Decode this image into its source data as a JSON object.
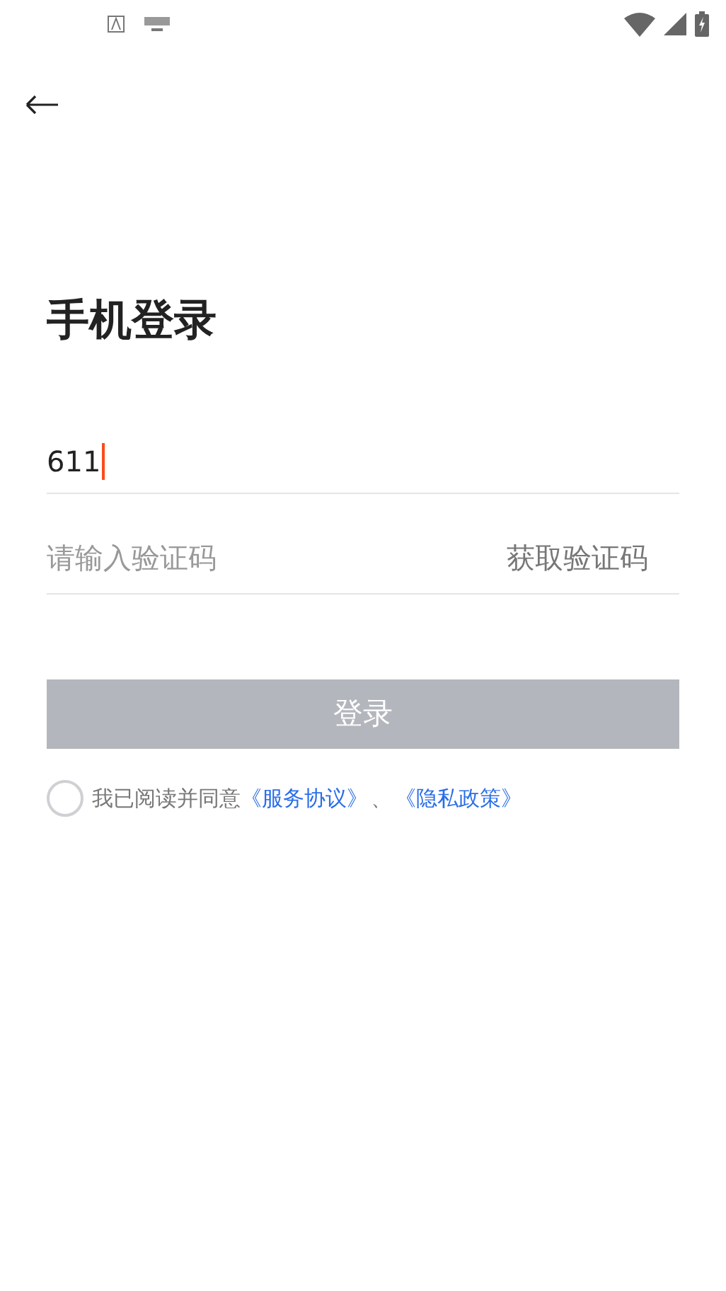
{
  "title": "手机登录",
  "phone_field": {
    "value": "611",
    "focused": true
  },
  "code_field": {
    "placeholder": "请输入验证码",
    "get_code_button": "获取验证码"
  },
  "login_button": {
    "label": "登录",
    "disabled": true
  },
  "agreement": {
    "checked": false,
    "text": "我已阅读并同意",
    "links": [
      "《服务协议》",
      "《隐私政策》"
    ],
    "separator": "、"
  }
}
